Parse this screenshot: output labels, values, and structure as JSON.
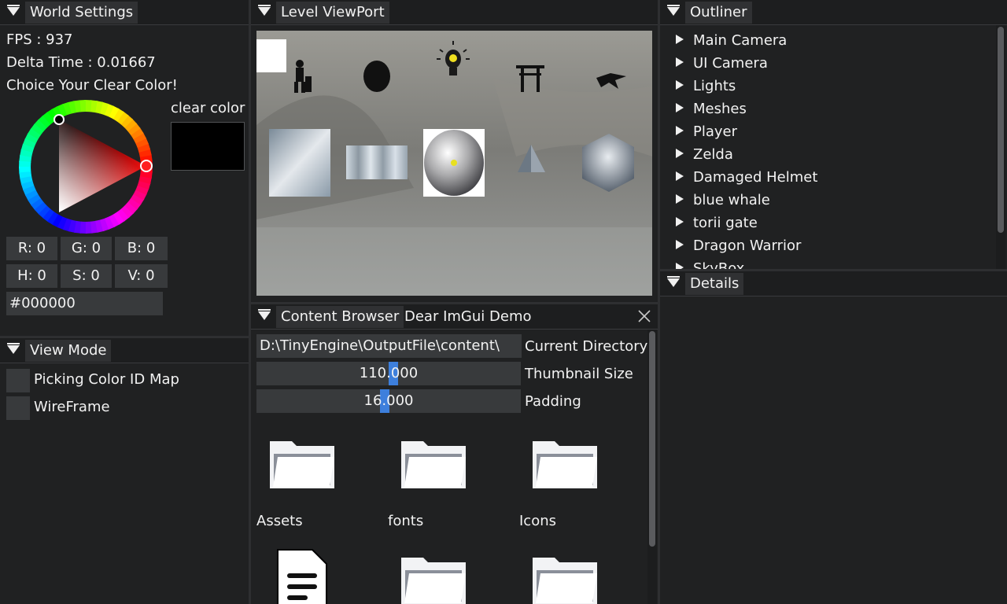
{
  "world_settings": {
    "tab": "World Settings",
    "fps": "FPS : 937",
    "delta_time": "Delta Time : 0.01667",
    "prompt": "Choice Your Clear Color!",
    "clear_color_label": "clear color",
    "r": "R:  0",
    "g": "G:  0",
    "b": "B:  0",
    "h": "H:  0",
    "s": "S:  0",
    "v": "V:  0",
    "hex": "#000000",
    "clear_color": "#000000"
  },
  "view_mode": {
    "tab": "View Mode",
    "options": [
      "Picking Color ID Map",
      "WireFrame"
    ]
  },
  "viewport": {
    "tab": "Level ViewPort"
  },
  "content_browser": {
    "tabs": [
      "Content Browser",
      "Dear ImGui Demo"
    ],
    "directory": "D:\\TinyEngine\\OutputFile\\content\\",
    "directory_label": "Current Directory",
    "thumbnail_size": "110.000",
    "thumbnail_label": "Thumbnail Size",
    "thumbnail_fraction": 0.55,
    "padding": "16.000",
    "padding_label": "Padding",
    "padding_fraction": 0.5,
    "items": [
      "Assets",
      "fonts",
      "Icons"
    ]
  },
  "outliner": {
    "tab": "Outliner",
    "items": [
      "Main Camera",
      "UI Camera",
      "Lights",
      "Meshes",
      "Player",
      "Zelda",
      "Damaged Helmet",
      "blue whale",
      "torii gate",
      "Dragon Warrior",
      "SkyBox"
    ]
  },
  "details": {
    "tab": "Details"
  }
}
